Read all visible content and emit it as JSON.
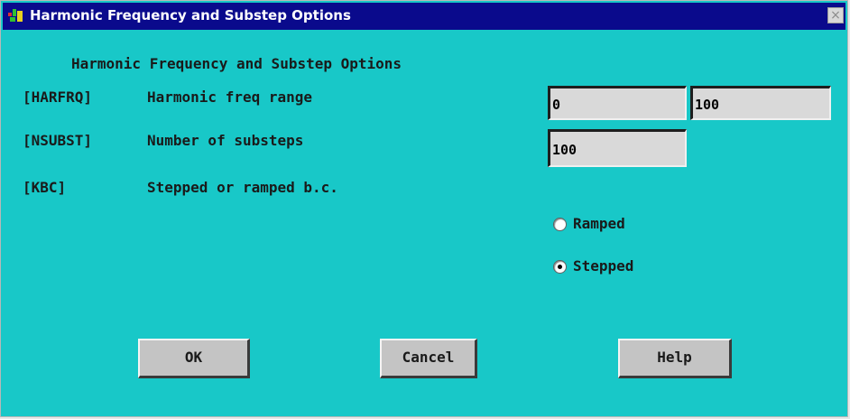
{
  "window": {
    "title": "Harmonic Frequency and Substep Options",
    "close_glyph": "×"
  },
  "dialog": {
    "heading": "Harmonic Frequency and Substep Options",
    "rows": [
      {
        "key": "[HARFRQ]",
        "label": "Harmonic freq range"
      },
      {
        "key": "[NSUBST]",
        "label": "Number of substeps"
      },
      {
        "key": "[KBC]",
        "label": "Stepped or ramped b.c."
      }
    ],
    "harfrq_start": "0",
    "harfrq_end": "100",
    "nsubst": "100",
    "kbc_options": [
      {
        "label": "Ramped",
        "selected": false
      },
      {
        "label": "Stepped",
        "selected": true
      }
    ]
  },
  "buttons": {
    "ok": "OK",
    "cancel": "Cancel",
    "help": "Help"
  },
  "colors": {
    "background": "#18c8c8",
    "titlebar": "#0a0a8c",
    "field": "#d9d9d9",
    "button": "#c4c4c4"
  }
}
